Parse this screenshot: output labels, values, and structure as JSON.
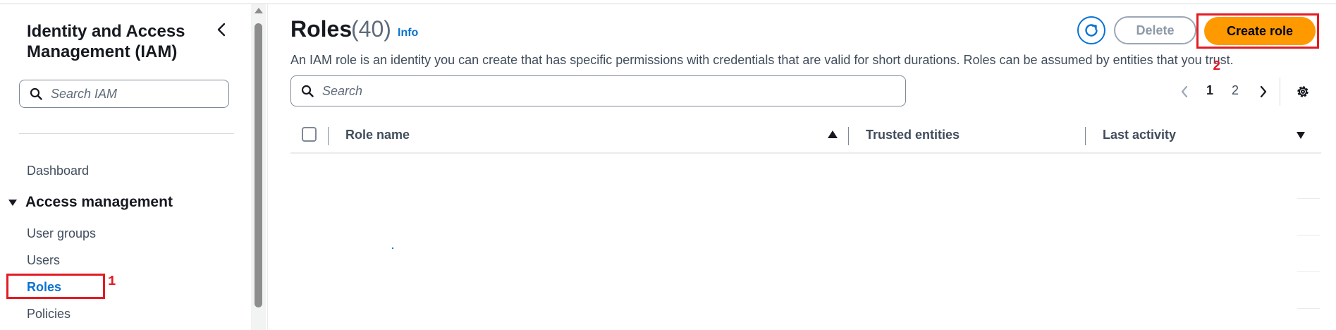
{
  "sidebar": {
    "title": "Identity and Access Management (IAM)",
    "search_placeholder": "Search IAM",
    "dashboard": "Dashboard",
    "section": "Access management",
    "items": [
      {
        "label": "User groups"
      },
      {
        "label": "Users"
      },
      {
        "label": "Roles"
      },
      {
        "label": "Policies"
      }
    ],
    "active_item": "Roles"
  },
  "annotations": {
    "step1": "1",
    "step2": "2",
    "color": "#e31b23"
  },
  "main": {
    "title": "Roles",
    "count": "(40)",
    "info": "Info",
    "description": "An IAM role is an identity you can create that has specific permissions with credentials that are valid for short durations. Roles can be assumed by entities that you trust.",
    "search_placeholder": "Search",
    "buttons": {
      "delete": "Delete",
      "create": "Create role"
    },
    "pagination": {
      "current": "1",
      "next_page": "2"
    },
    "columns": [
      {
        "label": "Role name"
      },
      {
        "label": "Trusted entities"
      },
      {
        "label": "Last activity"
      }
    ]
  },
  "colors": {
    "accent": "#0972d3",
    "primary_button": "#ff9900",
    "highlight": "#e31b23"
  },
  "icons": [
    "chevron-left-icon",
    "search-icon",
    "refresh-icon",
    "chevron-left-icon",
    "chevron-right-icon",
    "settings-icon",
    "sort-ascending-icon",
    "sort-descending-icon",
    "caret-down-icon"
  ]
}
